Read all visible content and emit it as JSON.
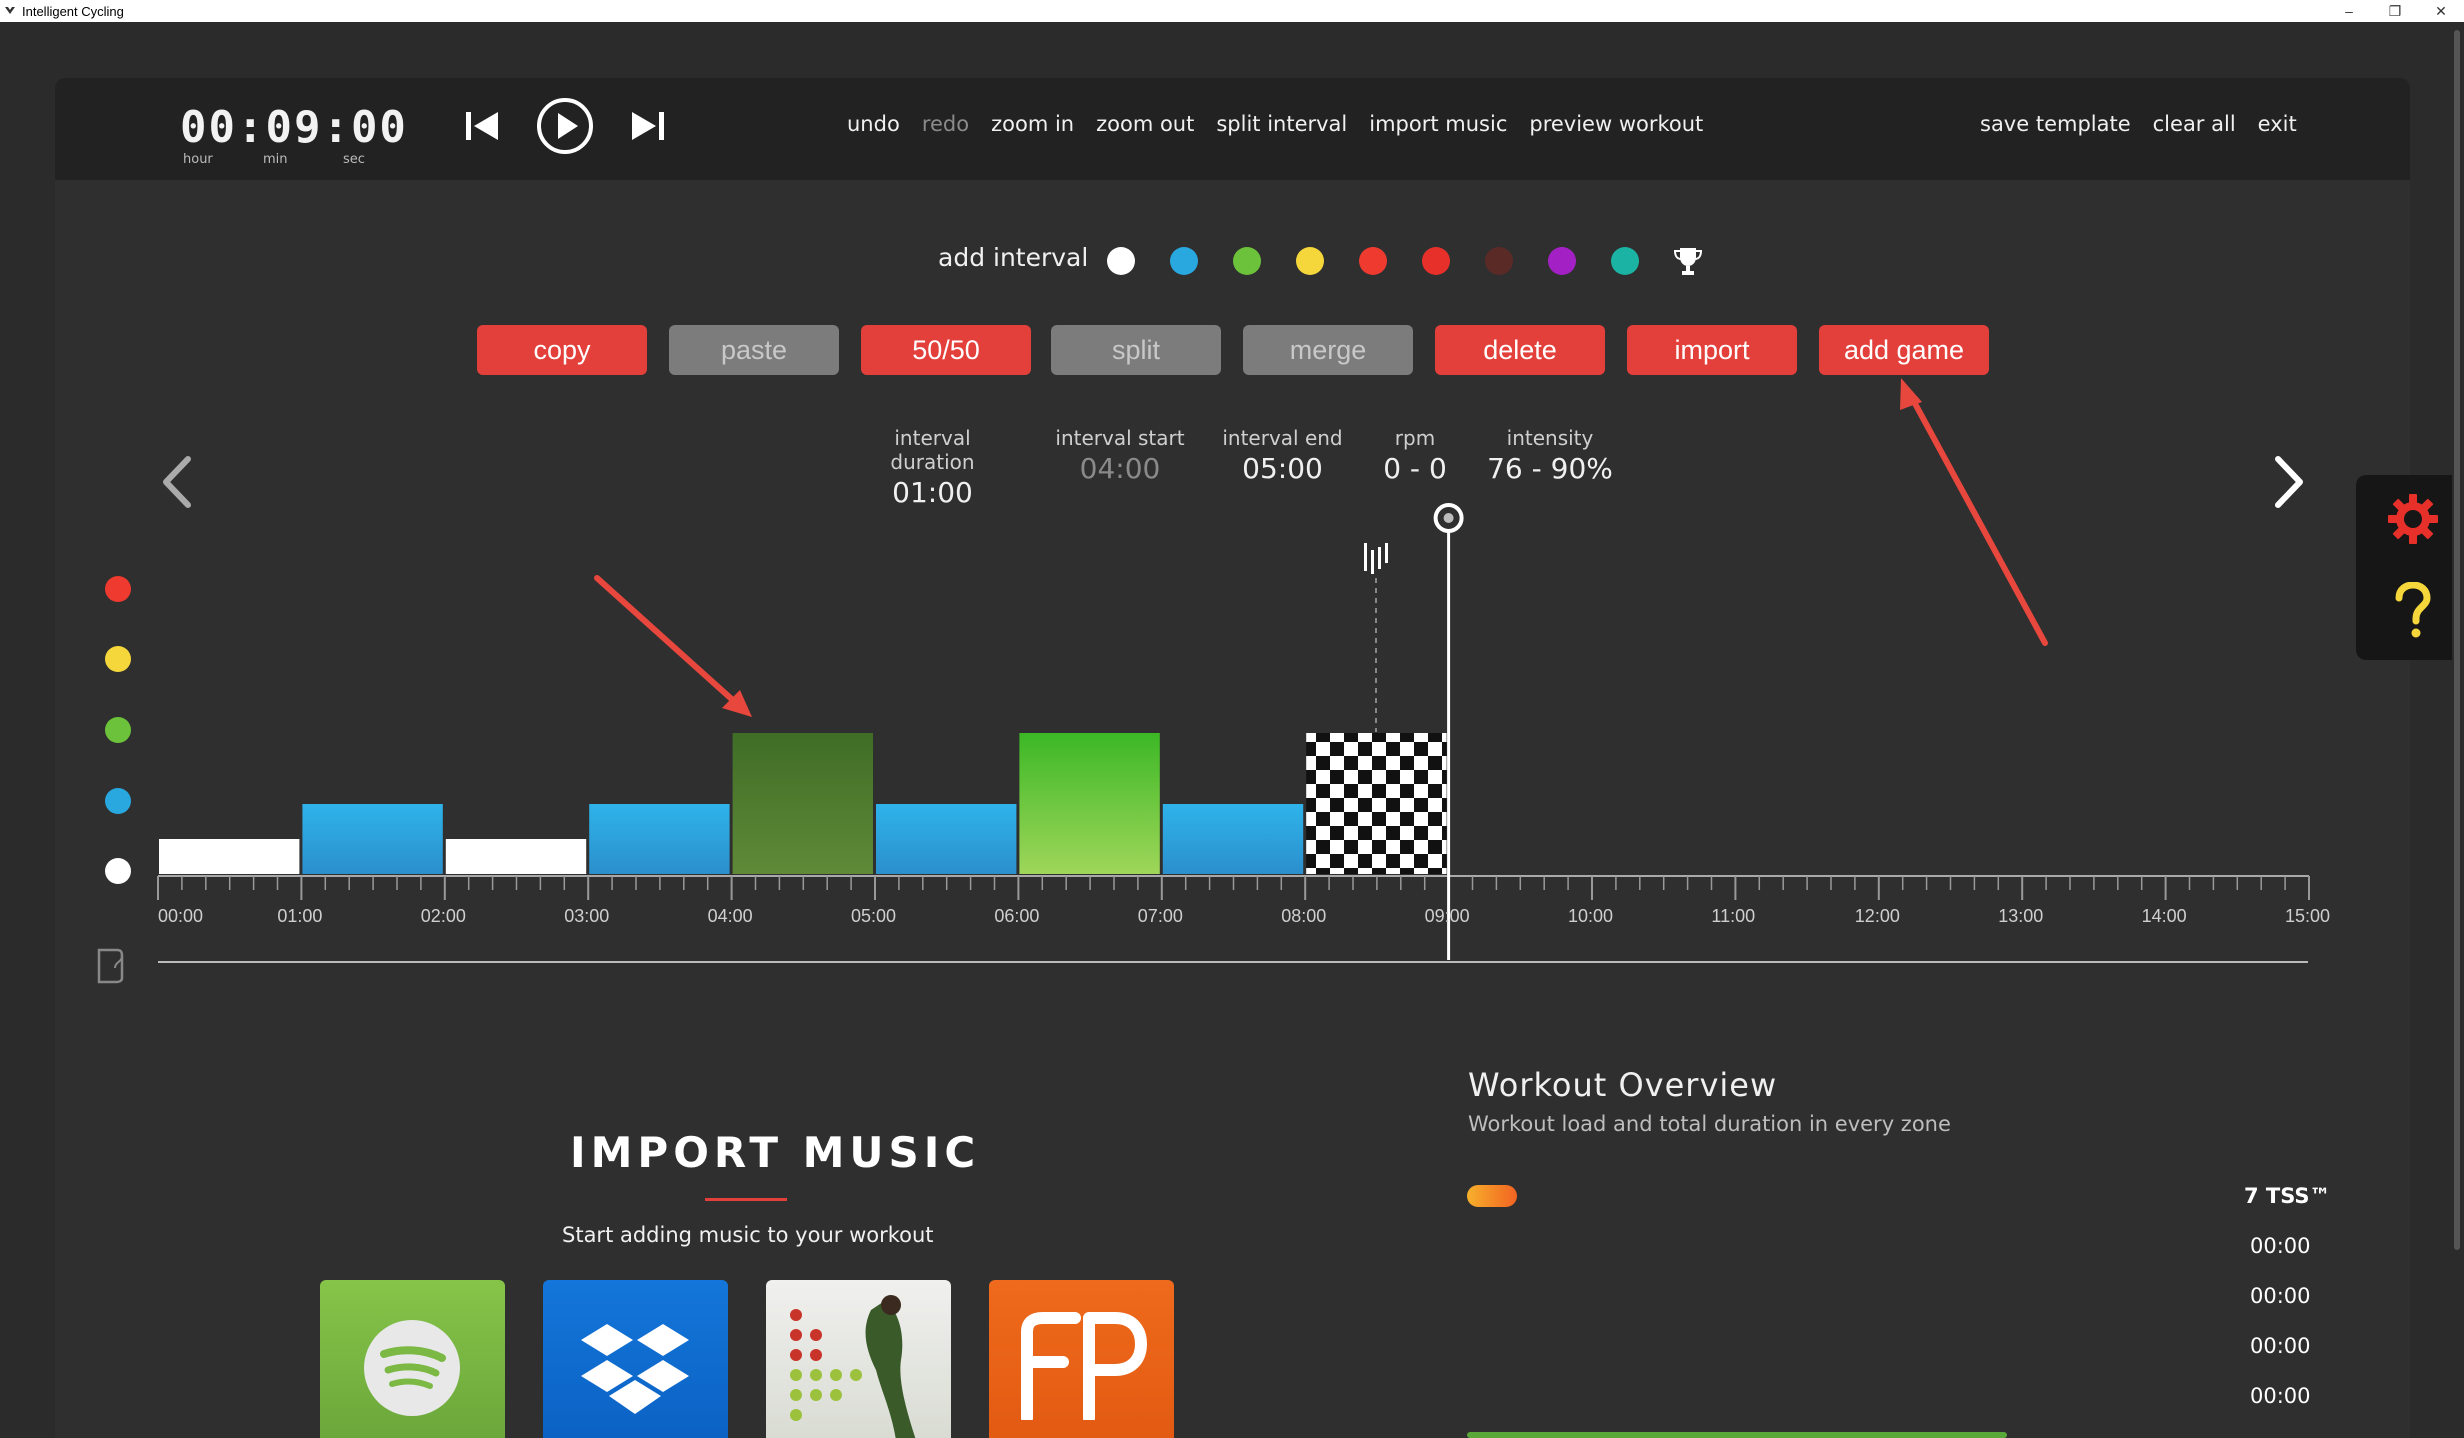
{
  "window": {
    "title": "Intelligent Cycling",
    "controls": [
      "–",
      "❐",
      "✕"
    ]
  },
  "timer": {
    "value": "00:09:00",
    "units": [
      "hour",
      "min",
      "sec"
    ]
  },
  "menu": {
    "undo": "undo",
    "redo": "redo",
    "zoom_in": "zoom in",
    "zoom_out": "zoom out",
    "split_interval": "split interval",
    "import_music": "import music",
    "preview_workout": "preview workout",
    "save_template": "save template",
    "clear_all": "clear all",
    "exit": "exit"
  },
  "add_interval": {
    "label": "add interval",
    "colors": [
      "#ffffff",
      "#29a8e0",
      "#6cc23a",
      "#f5d73b",
      "#ee3a2f",
      "#e8302a",
      "#5a2a26",
      "#a321c4",
      "#1bb3a3"
    ],
    "trophy_icon": "trophy-icon"
  },
  "buttons": {
    "copy": "copy",
    "paste": "paste",
    "fifty": "50/50",
    "split": "split",
    "merge": "merge",
    "delete": "delete",
    "import": "import",
    "add_game": "add game"
  },
  "interval_info": {
    "duration_label": "interval duration",
    "duration": "01:00",
    "start_label": "interval start",
    "start": "04:00",
    "end_label": "interval end",
    "end": "05:00",
    "rpm_label": "rpm",
    "rpm": "0 - 0",
    "intensity_label": "intensity",
    "intensity": "76 - 90%"
  },
  "zone_colors": [
    "#ee3a2f",
    "#f5d73b",
    "#6cc23a",
    "#29a8e0",
    "#ffffff"
  ],
  "timeline": {
    "ticks": [
      "00:00",
      "01:00",
      "02:00",
      "03:00",
      "04:00",
      "05:00",
      "06:00",
      "07:00",
      "08:00",
      "09:00",
      "10:00",
      "11:00",
      "12:00",
      "13:00",
      "14:00",
      "15:00"
    ],
    "intervals": [
      {
        "start": 0,
        "end": 1,
        "zone": 1,
        "color": "#ffffff"
      },
      {
        "start": 1,
        "end": 2,
        "zone": 2,
        "color": "#29a8e0"
      },
      {
        "start": 2,
        "end": 3,
        "zone": 1,
        "color": "#ffffff"
      },
      {
        "start": 3,
        "end": 4,
        "zone": 2,
        "color": "#29a8e0"
      },
      {
        "start": 4,
        "end": 5,
        "zone": 3,
        "color": "#4d7a2c"
      },
      {
        "start": 5,
        "end": 6,
        "zone": 2,
        "color": "#29a8e0"
      },
      {
        "start": 6,
        "end": 7,
        "zone": 3,
        "color": "#6cc23a"
      },
      {
        "start": 7,
        "end": 8,
        "zone": 2,
        "color": "#29a8e0"
      },
      {
        "start": 8,
        "end": 9,
        "zone": 3,
        "color": "checkered"
      }
    ],
    "playhead": 9
  },
  "import_music": {
    "title": "IMPORT MUSIC",
    "subtitle": "Start adding music to your workout",
    "services": [
      "spotify",
      "dropbox",
      "music-app",
      "fp"
    ]
  },
  "overview": {
    "title": "Workout Overview",
    "subtitle": "Workout load and total duration in every zone",
    "tss": "7  TSS™",
    "times": [
      "00:00",
      "00:00",
      "00:00",
      "00:00"
    ]
  }
}
